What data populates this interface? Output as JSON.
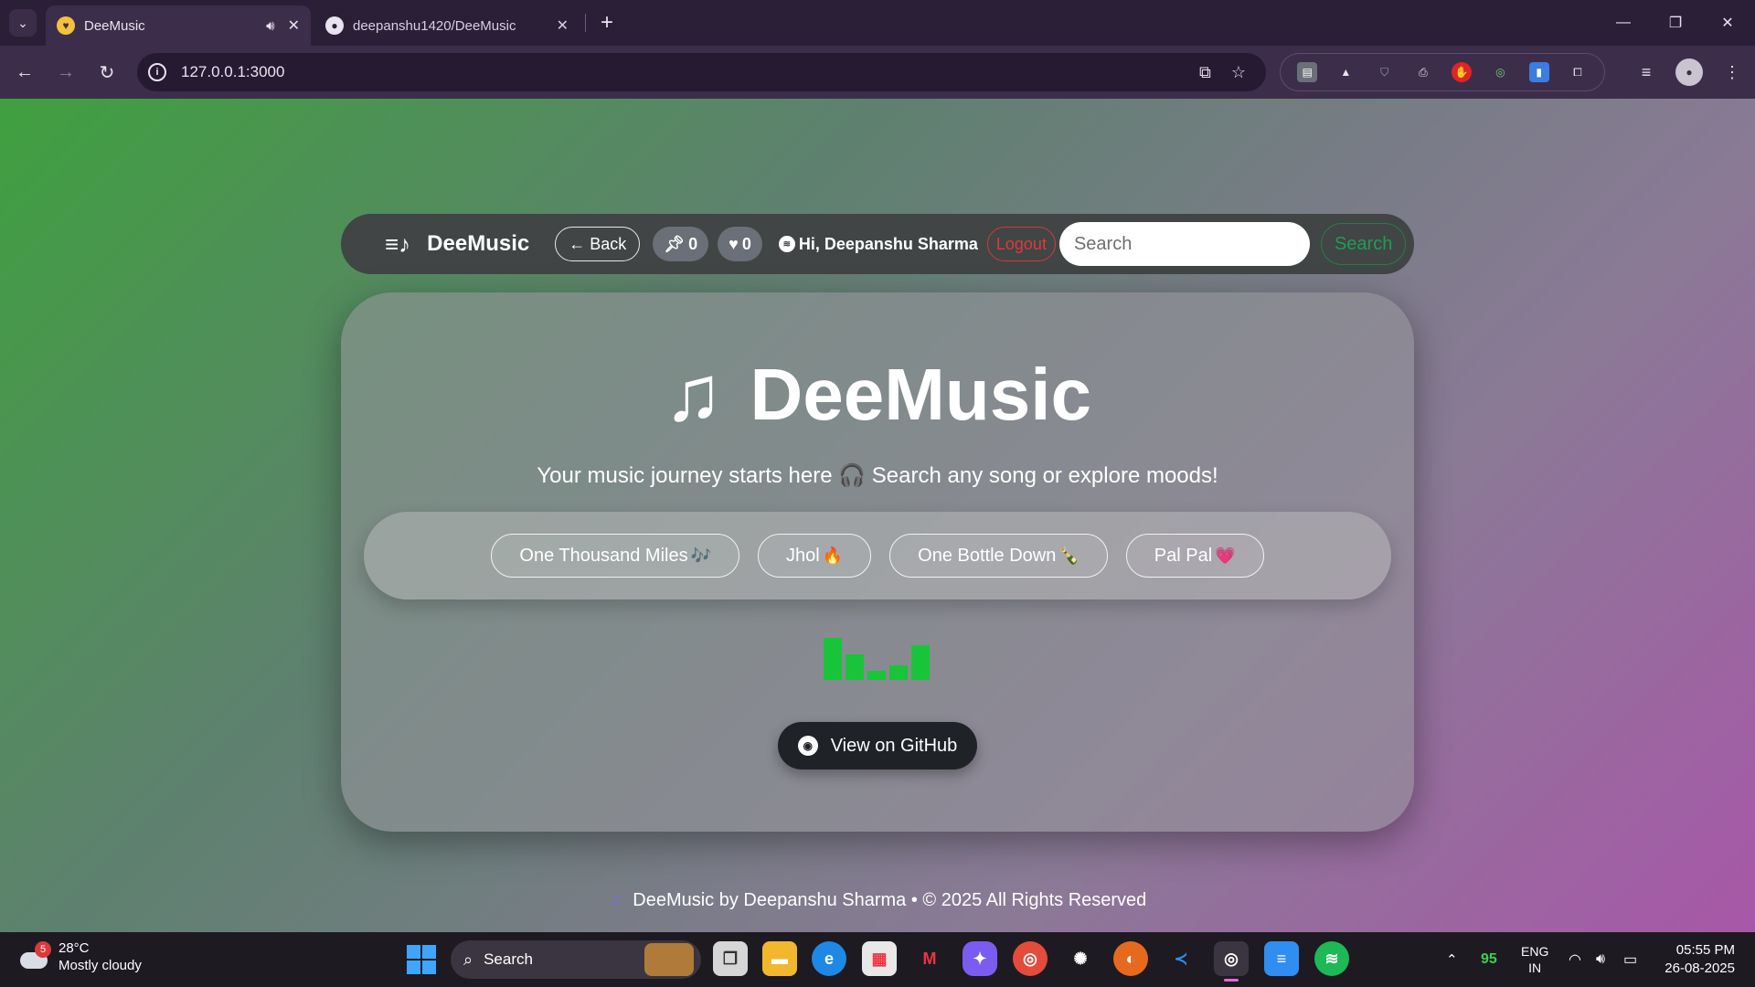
{
  "browser": {
    "tabs": [
      {
        "title": "DeeMusic",
        "active": true
      },
      {
        "title": "deepanshu1420/DeeMusic",
        "active": false
      }
    ],
    "url": "127.0.0.1:3000"
  },
  "navbar": {
    "brand": "DeeMusic",
    "back_label": "← Back",
    "pinned_count": "0",
    "liked_count": "0",
    "greeting": "Hi, Deepanshu Sharma",
    "logout_label": "Logout",
    "search_placeholder": "Search",
    "search_button": "Search"
  },
  "hero": {
    "title": "DeeMusic",
    "subtitle": "Your music journey starts here 🎧 Search any song or explore moods!",
    "moods": [
      {
        "label": "One Thousand Miles",
        "emoji": "🎶"
      },
      {
        "label": "Jhol",
        "emoji": "🔥"
      },
      {
        "label": "One Bottle Down",
        "emoji": "🍾"
      },
      {
        "label": "Pal Pal",
        "emoji": "💗"
      }
    ],
    "github_label": "View on GitHub"
  },
  "footer": {
    "text": "DeeMusic by Deepanshu Sharma • © 2025 All Rights Reserved"
  },
  "taskbar": {
    "weather_badge": "5",
    "temperature": "28°C",
    "condition": "Mostly cloudy",
    "search_label": "Search",
    "battery_value": "95",
    "lang_line1": "ENG",
    "lang_line2": "IN",
    "time": "05:55 PM",
    "date": "26-08-2025"
  },
  "colors": {
    "accent_green": "#19c43a",
    "logout_red": "#e0393c",
    "search_green": "#1f9d55"
  }
}
